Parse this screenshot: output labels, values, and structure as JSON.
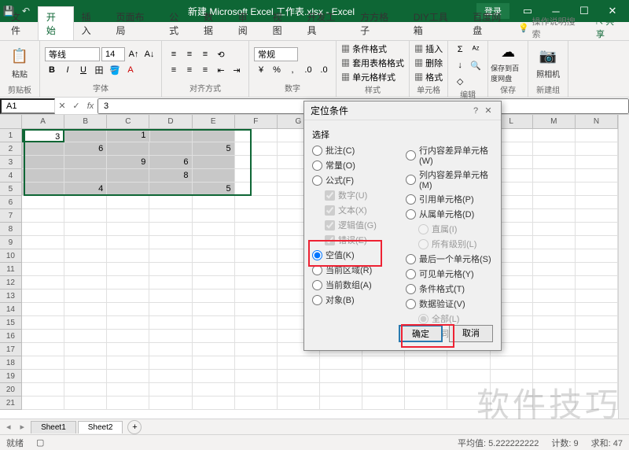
{
  "titlebar": {
    "title": "新建 Microsoft Excel 工作表.xlsx - Excel",
    "login": "登录"
  },
  "tabs": [
    "文件",
    "开始",
    "插入",
    "页面布局",
    "公式",
    "数据",
    "审阅",
    "视图",
    "开发工具",
    "方方格子",
    "DIY工具箱",
    "百度网盘"
  ],
  "active_tab": 1,
  "tellme": "操作说明搜索",
  "share": "共享",
  "ribbon": {
    "clipboard": {
      "label": "剪贴板",
      "paste": "粘贴"
    },
    "font": {
      "label": "字体",
      "name": "等线",
      "size": "14"
    },
    "align": {
      "label": "对齐方式"
    },
    "number": {
      "label": "数字",
      "fmt": "常规"
    },
    "styles": {
      "label": "样式",
      "cond": "条件格式",
      "table": "套用表格格式",
      "cell": "单元格样式"
    },
    "cells": {
      "label": "单元格",
      "insert": "插入",
      "delete": "删除",
      "format": "格式"
    },
    "editing": {
      "label": "编辑"
    },
    "baidu": {
      "label": "保存",
      "btn": "保存到百度网盘"
    },
    "camera": {
      "label": "新建组",
      "btn": "照相机"
    }
  },
  "namebox": "A1",
  "formula": "3",
  "cols": [
    "A",
    "B",
    "C",
    "D",
    "E",
    "F",
    "G",
    "H",
    "I",
    "J",
    "K",
    "L",
    "M",
    "N"
  ],
  "cells": {
    "r1": {
      "A": "3",
      "C": "1"
    },
    "r2": {
      "B": "6",
      "E": "5"
    },
    "r3": {
      "C": "9",
      "D": "6"
    },
    "r4": {
      "D": "8"
    },
    "r5": {
      "B": "4",
      "E": "5"
    }
  },
  "sheets": [
    "Sheet1",
    "Sheet2"
  ],
  "active_sheet": 1,
  "status": {
    "ready": "就绪",
    "avg": "平均值: 5.222222222",
    "count": "计数: 9",
    "sum": "求和: 47"
  },
  "dialog": {
    "title": "定位条件",
    "subtitle": "选择",
    "left": [
      {
        "t": "radio",
        "label": "批注(C)"
      },
      {
        "t": "radio",
        "label": "常量(O)"
      },
      {
        "t": "radio",
        "label": "公式(F)"
      },
      {
        "t": "check",
        "label": "数字(U)",
        "dis": true,
        "chk": true
      },
      {
        "t": "check",
        "label": "文本(X)",
        "dis": true,
        "chk": true
      },
      {
        "t": "check",
        "label": "逻辑值(G)",
        "dis": true,
        "chk": true
      },
      {
        "t": "check",
        "label": "错误(E)",
        "dis": true,
        "chk": true
      },
      {
        "t": "radio",
        "label": "空值(K)",
        "chk": true
      },
      {
        "t": "radio",
        "label": "当前区域(R)"
      },
      {
        "t": "radio",
        "label": "当前数组(A)"
      },
      {
        "t": "radio",
        "label": "对象(B)"
      }
    ],
    "right": [
      {
        "t": "radio",
        "label": "行内容差异单元格(W)"
      },
      {
        "t": "radio",
        "label": "列内容差异单元格(M)"
      },
      {
        "t": "radio",
        "label": "引用单元格(P)"
      },
      {
        "t": "radio",
        "label": "从属单元格(D)"
      },
      {
        "t": "radio",
        "label": "直属(I)",
        "dis": true,
        "chk": true
      },
      {
        "t": "radio",
        "label": "所有级别(L)",
        "dis": true
      },
      {
        "t": "radio",
        "label": "最后一个单元格(S)"
      },
      {
        "t": "radio",
        "label": "可见单元格(Y)"
      },
      {
        "t": "radio",
        "label": "条件格式(T)"
      },
      {
        "t": "radio",
        "label": "数据验证(V)"
      },
      {
        "t": "radio",
        "label": "全部(L)",
        "dis": true,
        "chk": true
      },
      {
        "t": "radio",
        "label": "相同(E)",
        "dis": true
      }
    ],
    "ok": "确定",
    "cancel": "取消"
  },
  "watermark": "软件技巧"
}
